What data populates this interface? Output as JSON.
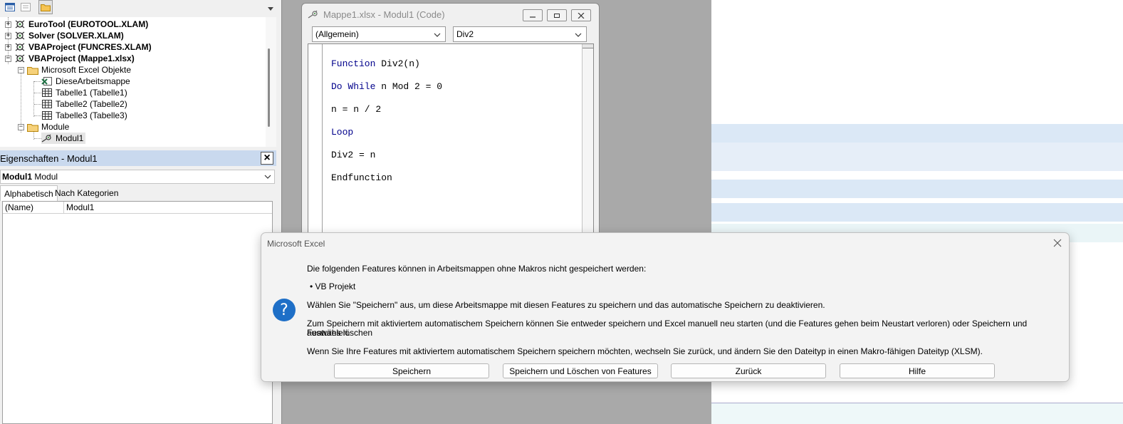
{
  "project_explorer": {
    "tree": [
      {
        "label": "EuroTool (EUROTOOL.XLAM)",
        "bold": true
      },
      {
        "label": "Solver (SOLVER.XLAM)",
        "bold": true
      },
      {
        "label": "VBAProject (FUNCRES.XLAM)",
        "bold": true
      },
      {
        "label": "VBAProject (Mappe1.xlsx)",
        "bold": true
      },
      {
        "label": "Microsoft Excel Objekte",
        "bold": false
      },
      {
        "label": "DieseArbeitsmappe",
        "bold": false
      },
      {
        "label": "Tabelle1 (Tabelle1)",
        "bold": false
      },
      {
        "label": "Tabelle2 (Tabelle2)",
        "bold": false
      },
      {
        "label": "Tabelle3 (Tabelle3)",
        "bold": false
      },
      {
        "label": "Module",
        "bold": false
      },
      {
        "label": "Modul1",
        "bold": false
      }
    ]
  },
  "properties": {
    "title": "Eigenschaften - Modul1",
    "object_name": "Modul1",
    "object_type": "Modul",
    "tabs": [
      "Alphabetisch",
      "Nach Kategorien"
    ],
    "rows": [
      {
        "key": "(Name)",
        "value": "Modul1"
      }
    ]
  },
  "code_window": {
    "title": "Mappe1.xlsx - Modul1 (Code)",
    "object_combo": "(Allgemein)",
    "proc_combo": "Div2",
    "lines": [
      {
        "kw": "Function",
        "rest": " Div2(n)"
      },
      {
        "kw": "Do While",
        "rest": " n Mod 2 = 0"
      },
      {
        "kw": "",
        "rest": "n = n / 2"
      },
      {
        "kw": "Loop",
        "rest": ""
      },
      {
        "kw": "",
        "rest": "Div2 = n"
      },
      {
        "kw": "",
        "rest": "Endfunction"
      }
    ]
  },
  "dialog": {
    "title": "Microsoft Excel",
    "line1": "Die folgenden Features können in Arbeitsmappen ohne Makros nicht gespeichert werden:",
    "bullet": "• VB Projekt",
    "line2": "Wählen Sie \"Speichern\" aus, um diese Arbeitsmappe mit diesen Features zu speichern und das automatische Speichern zu deaktivieren.",
    "line3a": "Zum Speichern mit aktiviertem automatischem Speichern können Sie entweder speichern und Excel manuell neu starten (und die Features gehen beim Neustart verloren) oder Speichern und Features löschen",
    "line3b": "auswählen.",
    "line4": "Wenn Sie Ihre Features mit aktiviertem automatischem Speichern speichern möchten, wechseln Sie zurück, und ändern Sie den Dateityp in einen Makro-fähigen Dateityp (XLSM).",
    "buttons": {
      "save": "Speichern",
      "save_delete": "Speichern und Löschen von Features",
      "back": "Zurück",
      "help": "Hilfe"
    }
  },
  "colors": {
    "dialog_icon": "#1e6fc7",
    "vba_keyword": "#00008b",
    "selection_band": "#dbe8f6"
  }
}
